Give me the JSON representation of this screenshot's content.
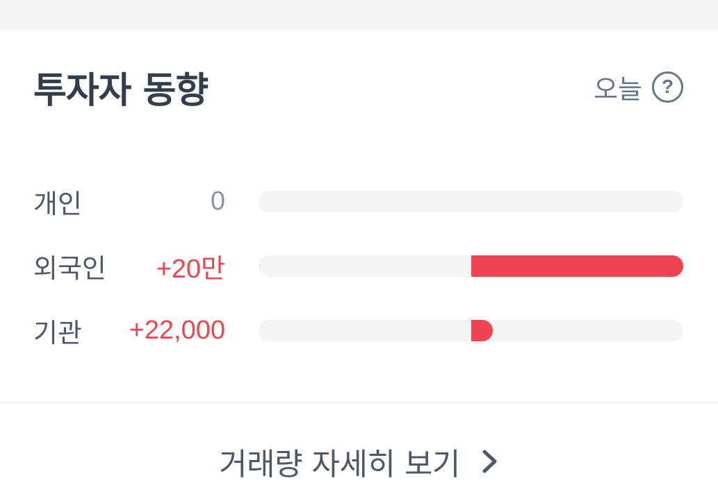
{
  "card": {
    "title": "투자자 동향",
    "period_label": "오늘",
    "help_icon": "question-circle-icon"
  },
  "investors": [
    {
      "label": "개인",
      "value": "0",
      "value_color": "#8b95a1",
      "direction": "none",
      "fill_fraction": 0.0
    },
    {
      "label": "외국인",
      "value": "+20만",
      "value_color": "#f04452",
      "direction": "buy",
      "fill_fraction": 1.0
    },
    {
      "label": "기관",
      "value": "+22,000",
      "value_color": "#f04452",
      "direction": "buy",
      "fill_fraction": 0.1
    }
  ],
  "footer": {
    "link_label": "거래량 자세히 보기",
    "chevron_icon": "chevron-right-icon"
  },
  "colors": {
    "buy": "#f04452",
    "neutral": "#8b95a1",
    "track": "#f2f4f6",
    "title": "#333d4b"
  }
}
